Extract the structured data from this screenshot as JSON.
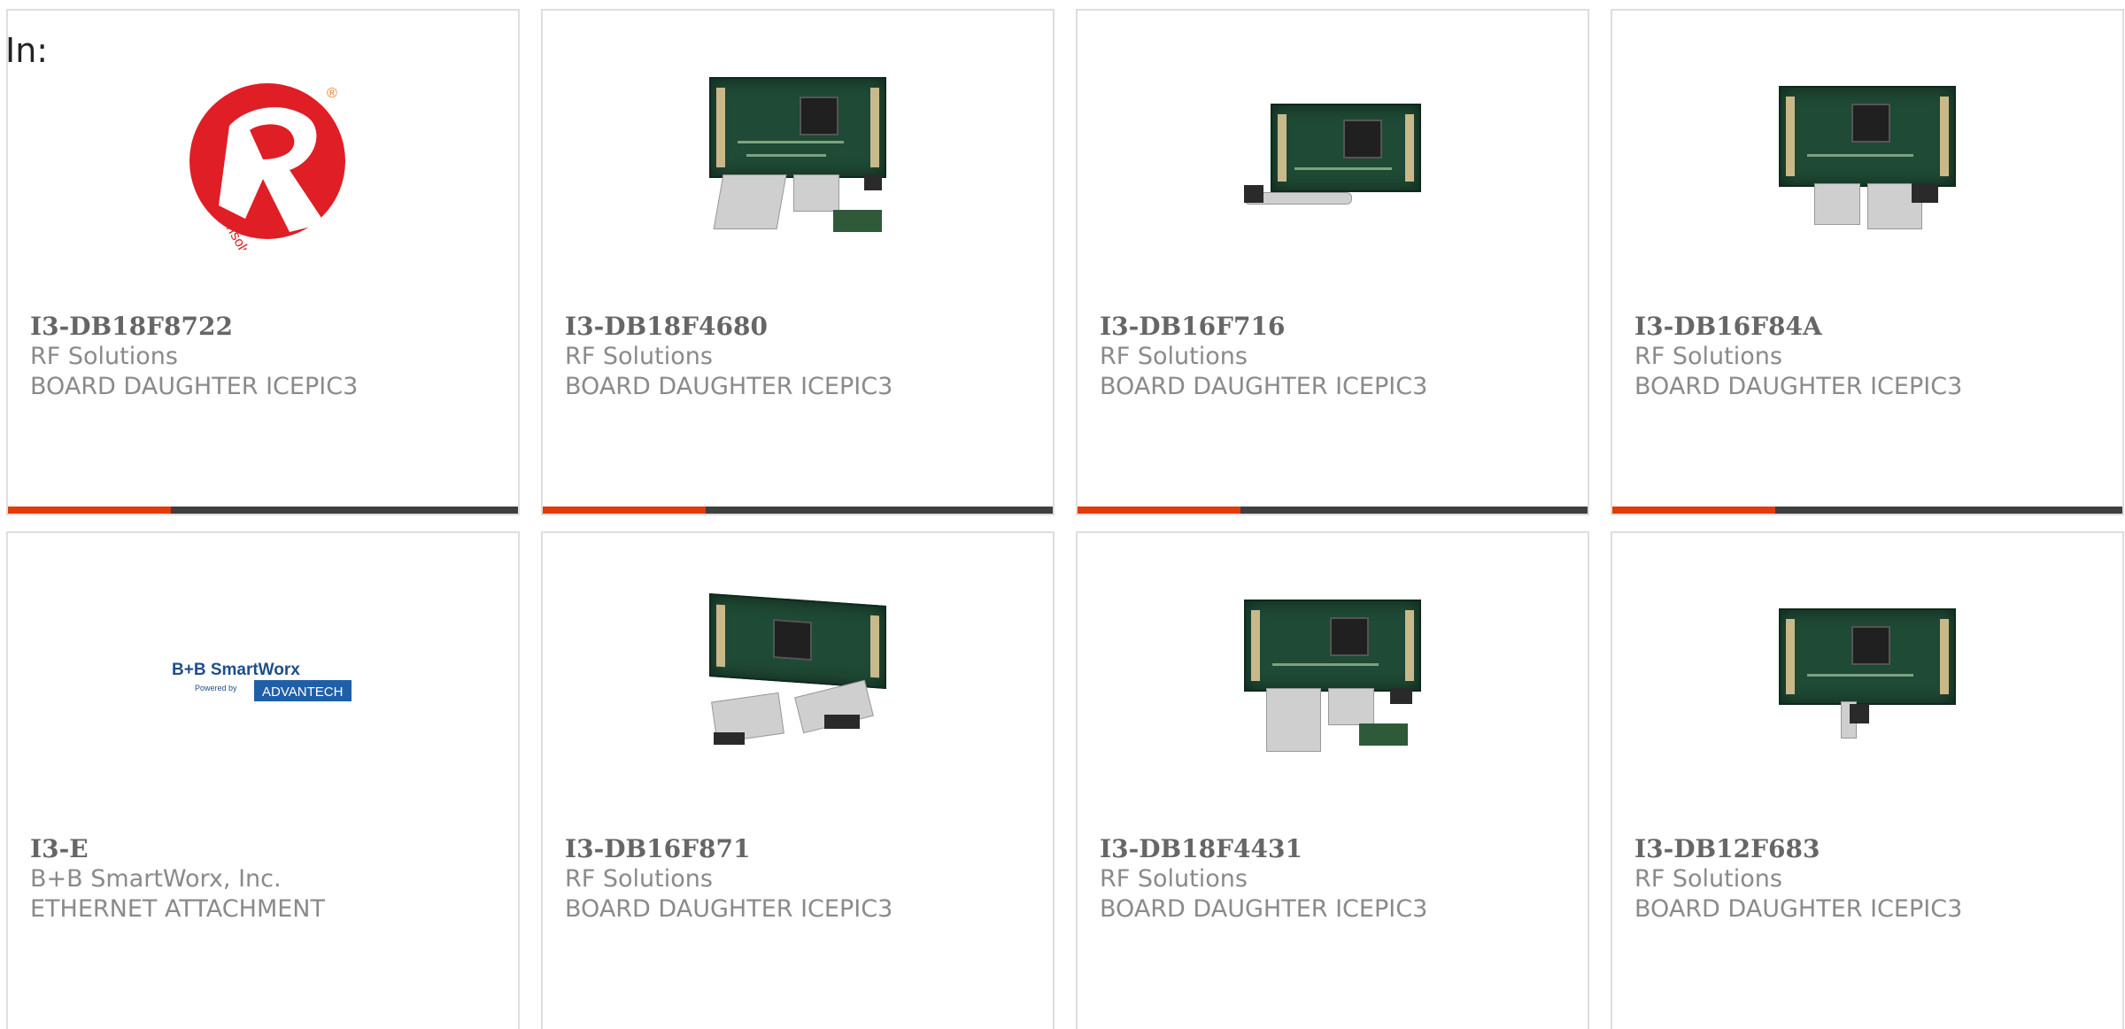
{
  "header": {
    "in_label": "In:"
  },
  "colors": {
    "accent": "#e33a0b",
    "bar": "#3f3f3f",
    "border": "#dedede"
  },
  "products": [
    {
      "part_number": "I3-DB18F8722",
      "manufacturer": "RF Solutions",
      "description": "BOARD DAUGHTER ICEPIC3",
      "image": "rf-solutions-logo",
      "has_bar": true
    },
    {
      "part_number": "I3-DB18F4680",
      "manufacturer": "RF Solutions",
      "description": "BOARD DAUGHTER ICEPIC3",
      "image": "daughter-board-photo",
      "has_bar": true
    },
    {
      "part_number": "I3-DB16F716",
      "manufacturer": "RF Solutions",
      "description": "BOARD DAUGHTER ICEPIC3",
      "image": "daughter-board-photo",
      "has_bar": true
    },
    {
      "part_number": "I3-DB16F84A",
      "manufacturer": "RF Solutions",
      "description": "BOARD DAUGHTER ICEPIC3",
      "image": "daughter-board-photo",
      "has_bar": true
    },
    {
      "part_number": "I3-E",
      "manufacturer": "B+B SmartWorx, Inc.",
      "description": "ETHERNET ATTACHMENT",
      "image": "bb-smartworx-logo",
      "has_bar": false
    },
    {
      "part_number": "I3-DB16F871",
      "manufacturer": "RF Solutions",
      "description": "BOARD DAUGHTER ICEPIC3",
      "image": "daughter-board-photo",
      "has_bar": false
    },
    {
      "part_number": "I3-DB18F4431",
      "manufacturer": "RF Solutions",
      "description": "BOARD DAUGHTER ICEPIC3",
      "image": "daughter-board-photo",
      "has_bar": false
    },
    {
      "part_number": "I3-DB12F683",
      "manufacturer": "RF Solutions",
      "description": "BOARD DAUGHTER ICEPIC3",
      "image": "daughter-board-photo",
      "has_bar": false
    }
  ],
  "logos": {
    "rf": {
      "letters": "RF",
      "tagline": "rfsolutions",
      "registered": "®"
    },
    "bb": {
      "line1": "B+B SmartWorx",
      "powered": "Powered by",
      "brand": "ADVANTECH"
    }
  }
}
